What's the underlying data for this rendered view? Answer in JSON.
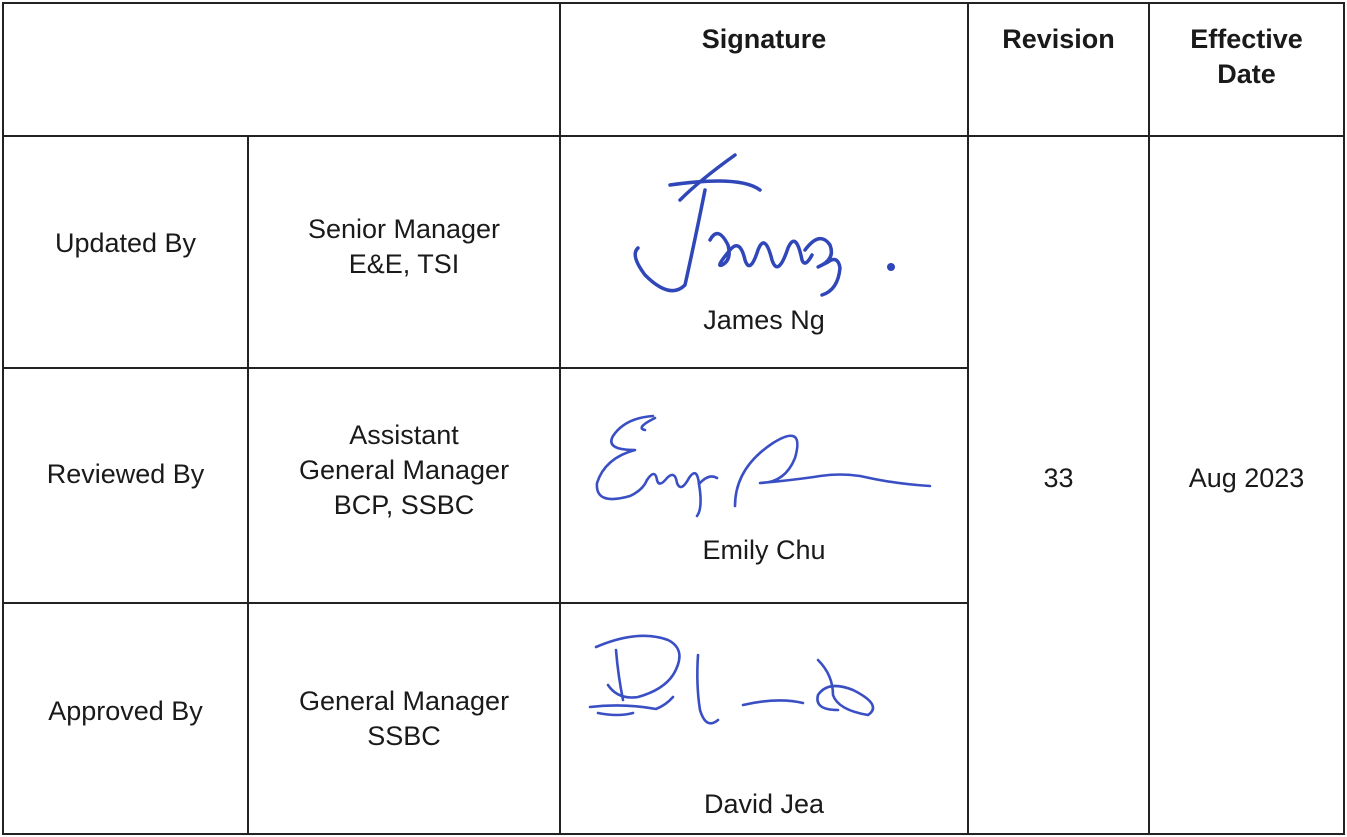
{
  "header": {
    "signature": "Signature",
    "revision": "Revision",
    "effective_date": "Effective\nDate"
  },
  "rows": [
    {
      "role": "Updated By",
      "title": "Senior Manager\nE&E, TSI",
      "signatory": "James Ng"
    },
    {
      "role": "Reviewed By",
      "title": "Assistant\nGeneral Manager\nBCP, SSBC",
      "signatory": "Emily Chu"
    },
    {
      "role": "Approved By",
      "title": "General Manager\nSSBC",
      "signatory": "David Jea"
    }
  ],
  "revision": "33",
  "effective_date": "Aug 2023",
  "colors": {
    "ink": "#2f47b8",
    "border": "#222222"
  }
}
